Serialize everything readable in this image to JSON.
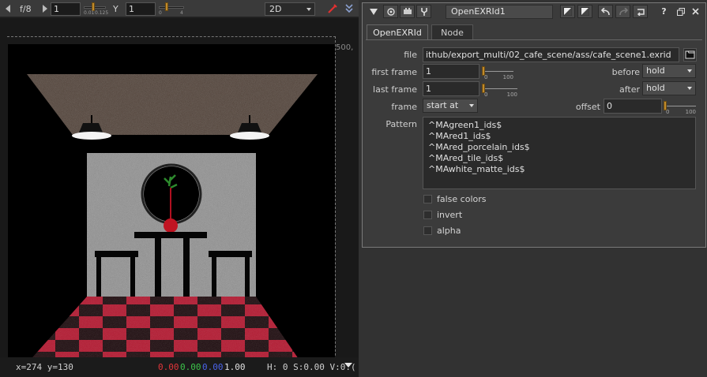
{
  "viewer": {
    "toolbar": {
      "fstop": "f/8",
      "gain_value": "1",
      "gain_ticks": [
        "0.01",
        "0.125"
      ],
      "gamma_label": "Y",
      "gamma_value": "1",
      "gamma_ticks": [
        "0",
        "4"
      ],
      "view_mode": "2D"
    },
    "resolution_label": "500,",
    "status": {
      "coords": "x=274 y=130",
      "r": "0.00",
      "g": "0.00",
      "b": "0.00",
      "a": "1.00",
      "hsv": "H:  0 S:0.00 V:0.("
    },
    "colors": {
      "r": "#e0353a",
      "g": "#3cc34a",
      "b": "#4a63e8"
    }
  },
  "properties": {
    "node_name": "OpenEXRId1",
    "tabs": [
      "OpenEXRId",
      "Node"
    ],
    "file_label": "file",
    "file_value": "ithub/export_multi/02_cafe_scene/ass/cafe_scene1.exrid",
    "first_frame_label": "first frame",
    "first_frame_value": "1",
    "first_frame_ticks": [
      "0",
      "100"
    ],
    "before_label": "before",
    "before_value": "hold",
    "last_frame_label": "last frame",
    "last_frame_value": "1",
    "last_frame_ticks": [
      "0",
      "100"
    ],
    "after_label": "after",
    "after_value": "hold",
    "frame_label": "frame",
    "frame_value": "start at",
    "offset_label": "offset",
    "offset_value": "0",
    "offset_ticks": [
      "0",
      "100"
    ],
    "pattern_label": "Pattern",
    "pattern_lines": [
      "^MAgreen1_ids$",
      "^MAred1_ids$",
      "^MAred_porcelain_ids$",
      "^MAred_tile_ids$",
      "^MAwhite_matte_ids$"
    ],
    "checkboxes": [
      {
        "label": "false colors",
        "checked": false
      },
      {
        "label": "invert",
        "checked": false
      },
      {
        "label": "alpha",
        "checked": false
      }
    ],
    "help_label": "?"
  }
}
